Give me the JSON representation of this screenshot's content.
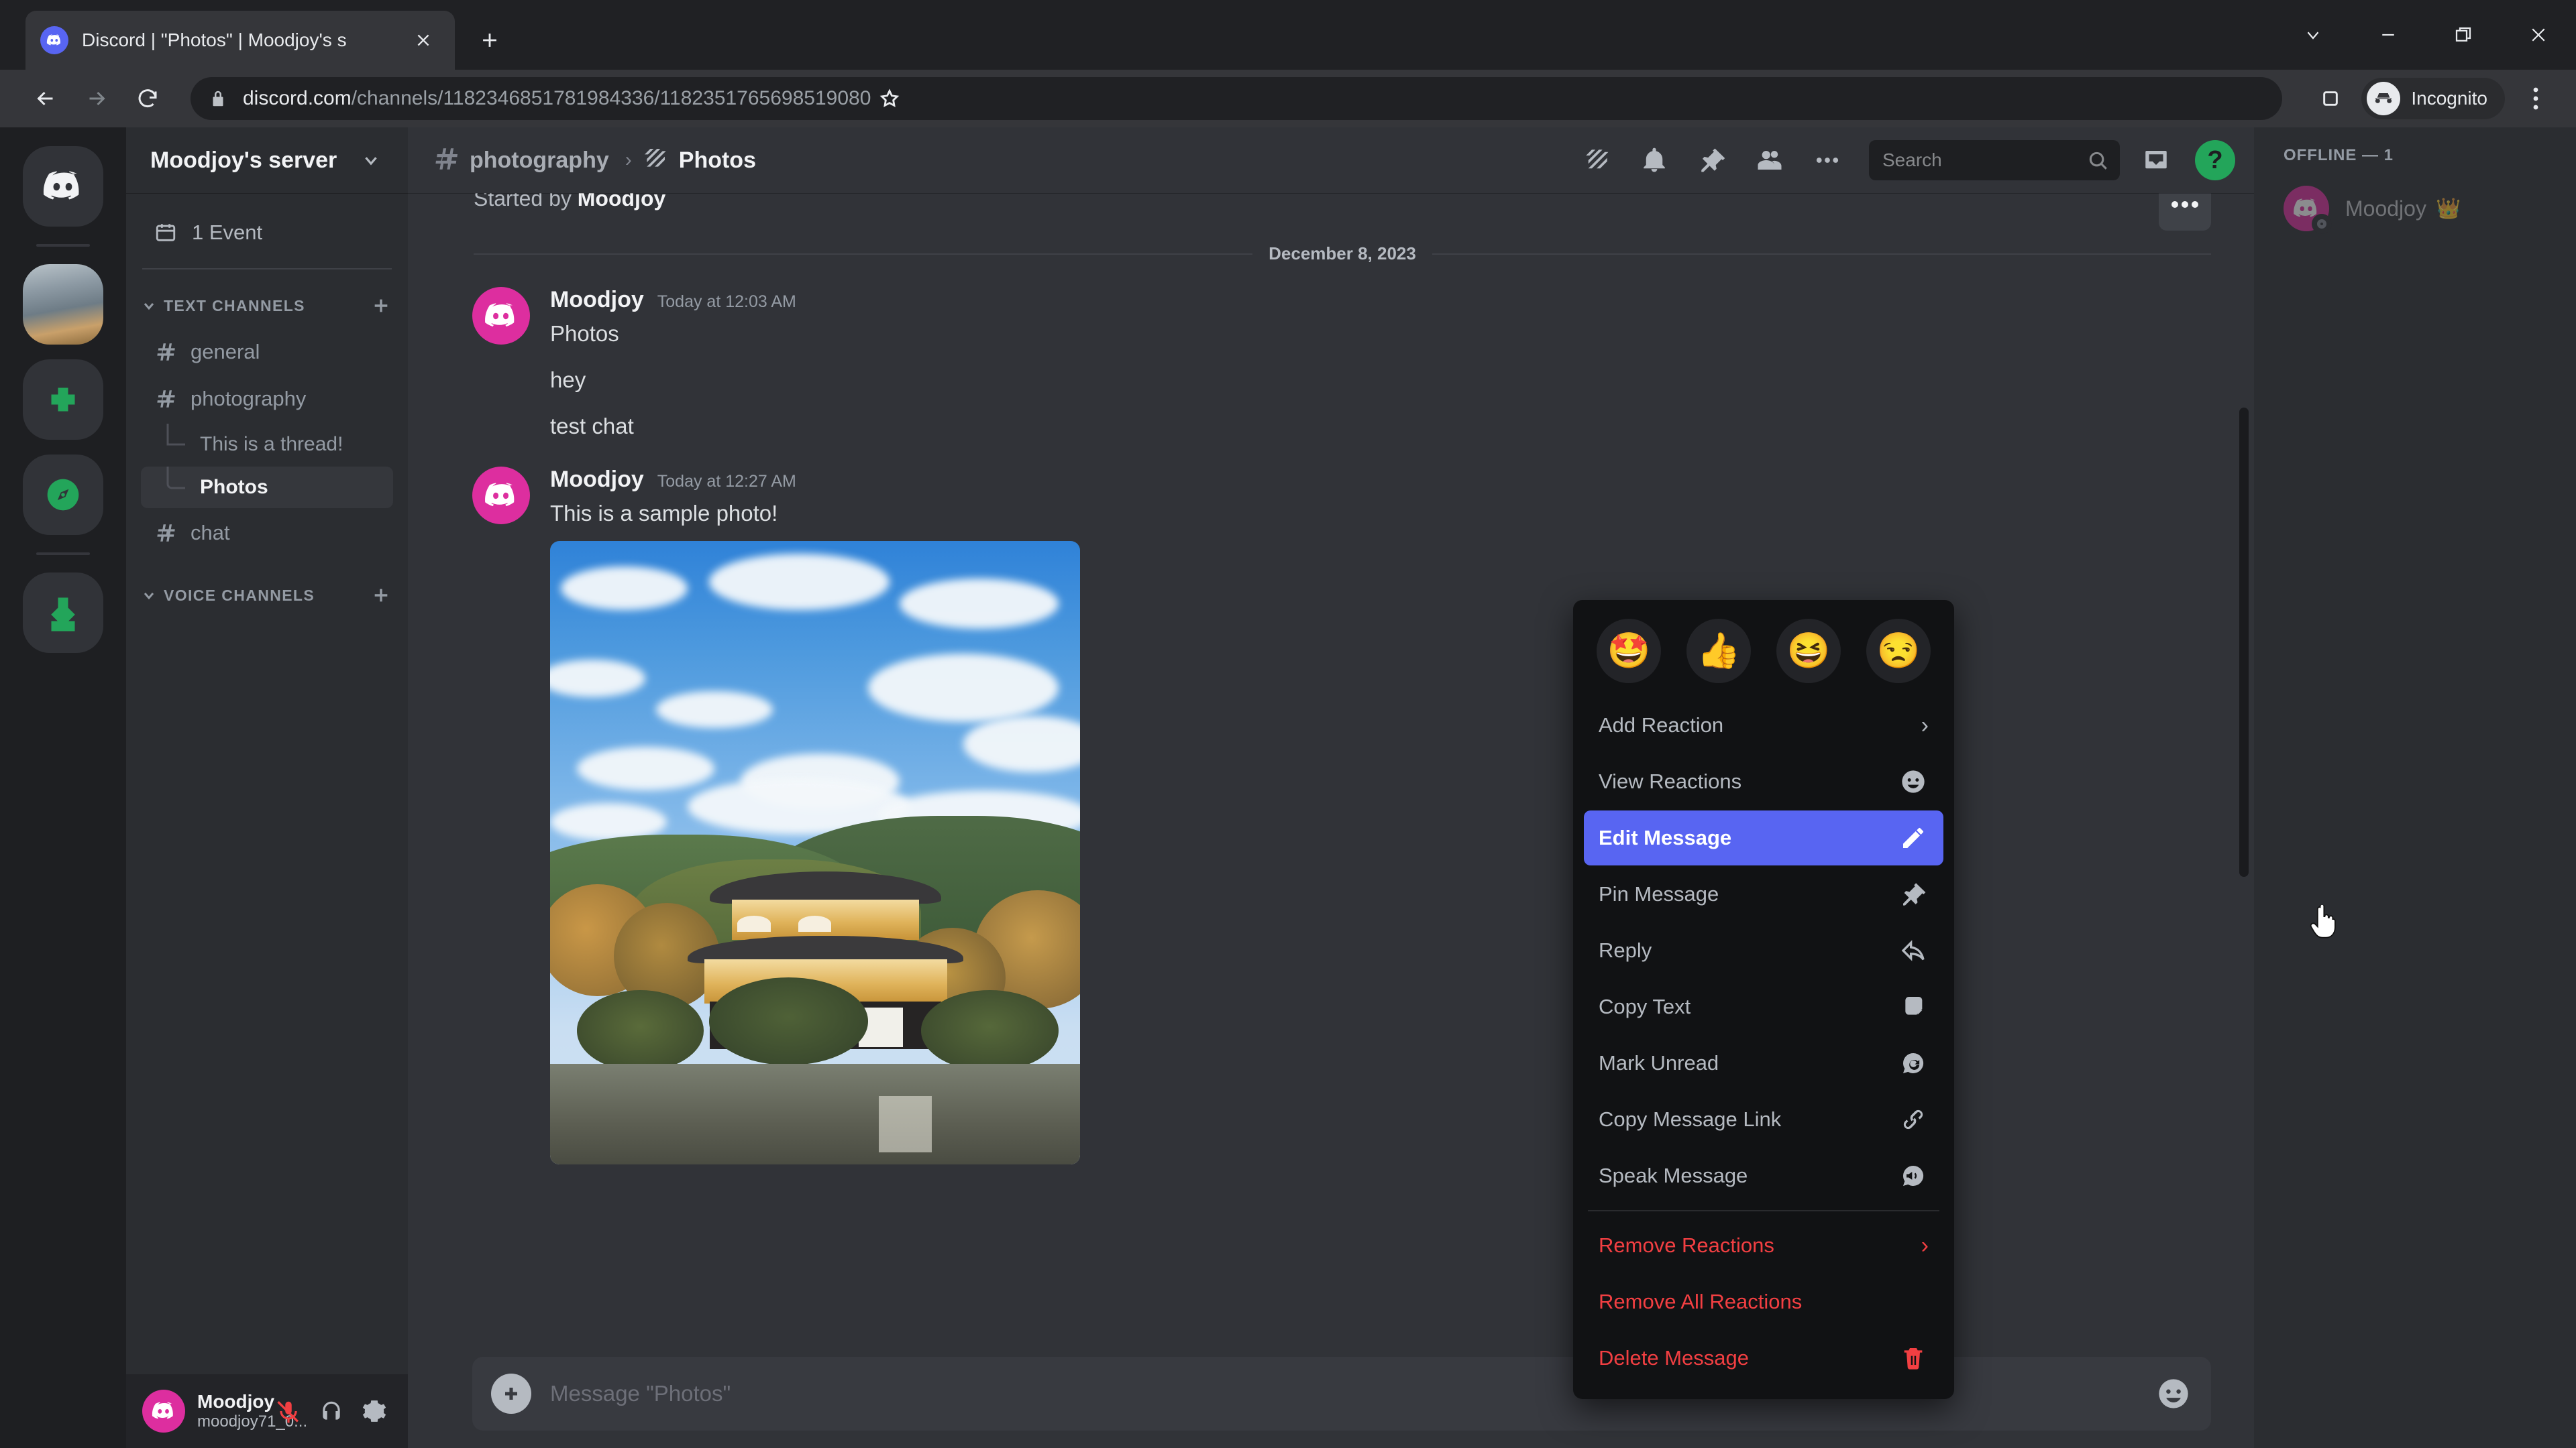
{
  "browser": {
    "tab": {
      "title": "Discord | \"Photos\" | Moodjoy's s",
      "favicon_icon": "discord-icon",
      "close_icon": "close-icon"
    },
    "new_tab_icon": "plus-icon",
    "window_controls": [
      {
        "name": "tab-search",
        "icon": "chevron-down-icon"
      },
      {
        "name": "minimize",
        "icon": "minimize-icon"
      },
      {
        "name": "maximize",
        "icon": "restore-icon"
      },
      {
        "name": "close",
        "icon": "close-icon"
      }
    ],
    "nav": {
      "back_icon": "arrow-left-icon",
      "forward_icon": "arrow-right-icon",
      "reload_icon": "reload-icon"
    },
    "omnibox": {
      "lock_icon": "lock-icon",
      "url_domain": "discord.com",
      "url_path": "/channels/1182346851781984336/1182351765698519080",
      "bookmark_icon": "star-icon"
    },
    "side_panel_icon": "side-panel-icon",
    "profile": {
      "label": "Incognito",
      "icon": "incognito-icon"
    },
    "menu_icon": "kebab-menu-icon"
  },
  "rail": {
    "home_icon": "discord-home-icon",
    "items": [
      {
        "name": "server-moodjoy",
        "type": "server-avatar",
        "active": true
      },
      {
        "name": "add-server",
        "icon": "plus-icon"
      },
      {
        "name": "explore-servers",
        "icon": "compass-icon"
      },
      {
        "name": "download-apps",
        "icon": "download-icon"
      }
    ]
  },
  "sidebar": {
    "server_name": "Moodjoy's server",
    "server_chevron_icon": "chevron-down-icon",
    "event": {
      "label": "1 Event",
      "icon": "calendar-icon"
    },
    "categories": [
      {
        "label": "TEXT CHANNELS",
        "add_icon": "plus-icon",
        "chevron_icon": "chevron-down-icon",
        "channels": [
          {
            "name": "general",
            "icon": "hash-icon",
            "active": false,
            "threads": []
          },
          {
            "name": "photography",
            "icon": "hash-icon",
            "active": false,
            "threads": [
              {
                "name": "This is a thread!",
                "active": false
              },
              {
                "name": "Photos",
                "active": true
              }
            ]
          },
          {
            "name": "chat",
            "icon": "hash-icon",
            "active": false,
            "threads": []
          }
        ]
      },
      {
        "label": "VOICE CHANNELS",
        "add_icon": "plus-icon",
        "chevron_icon": "chevron-down-icon",
        "channels": []
      }
    ],
    "user_panel": {
      "name": "Moodjoy",
      "tag": "moodjoy71_0...",
      "mic_icon": "mic-muted-icon",
      "headset_icon": "headset-icon",
      "settings_icon": "gear-icon"
    }
  },
  "chat_header": {
    "parent_channel": "photography",
    "parent_icon": "hash-icon",
    "separator": "›",
    "thread_name": "Photos",
    "thread_icon": "threads-icon",
    "icons": [
      {
        "name": "threads-icon"
      },
      {
        "name": "notification-bell-icon"
      },
      {
        "name": "pin-icon"
      },
      {
        "name": "members-icon"
      },
      {
        "name": "more-options-icon"
      }
    ],
    "search": {
      "placeholder": "Search",
      "icon": "search-icon"
    },
    "inbox_icon": "inbox-icon",
    "help": {
      "label": "?",
      "icon": "help-icon",
      "color": "#23a55a"
    }
  },
  "conversation": {
    "started_by_prefix": "Started by ",
    "started_by_user": "Moodjoy",
    "date_divider": "December 8, 2023",
    "messages": [
      {
        "author": "Moodjoy",
        "timestamp": "Today at 12:03 AM",
        "lines": [
          "Photos",
          "hey",
          "test chat"
        ],
        "has_photo": false
      },
      {
        "author": "Moodjoy",
        "timestamp": "Today at 12:27 AM",
        "lines": [
          "This is a sample photo!"
        ],
        "has_photo": true,
        "photo_alt": "Kinkaku-ji Golden Pavilion temple with blue sky and pond"
      }
    ],
    "hover_actions": {
      "more_icon": "more-options-icon"
    }
  },
  "composer": {
    "plus_icon": "plus-circle-icon",
    "placeholder": "Message \"Photos\"",
    "emoji_icon": "emoji-icon"
  },
  "members": {
    "category": "OFFLINE — 1",
    "list": [
      {
        "name": "Moodjoy",
        "badge": "👑",
        "status": "offline"
      }
    ]
  },
  "context_menu": {
    "quick_reactions": [
      "🤩",
      "👍",
      "😆",
      "😒"
    ],
    "items": [
      {
        "label": "Add Reaction",
        "icon": "chevron-right-icon",
        "type": "submenu",
        "active": false
      },
      {
        "label": "View Reactions",
        "icon": "smiley-icon",
        "type": "normal",
        "active": false
      },
      {
        "label": "Edit Message",
        "icon": "pencil-icon",
        "type": "normal",
        "active": true
      },
      {
        "label": "Pin Message",
        "icon": "pin-icon",
        "type": "normal",
        "active": false
      },
      {
        "label": "Reply",
        "icon": "reply-arrow-icon",
        "type": "normal",
        "active": false
      },
      {
        "label": "Copy Text",
        "icon": "copy-icon",
        "type": "normal",
        "active": false
      },
      {
        "label": "Mark Unread",
        "icon": "mark-unread-icon",
        "type": "normal",
        "active": false
      },
      {
        "label": "Copy Message Link",
        "icon": "link-icon",
        "type": "normal",
        "active": false
      },
      {
        "label": "Speak Message",
        "icon": "speaker-icon",
        "type": "normal",
        "active": false
      },
      {
        "label": "Remove Reactions",
        "icon": "chevron-right-icon",
        "type": "submenu",
        "danger": true,
        "active": false
      },
      {
        "label": "Remove All Reactions",
        "icon": "",
        "type": "normal",
        "danger": true,
        "active": false
      },
      {
        "label": "Delete Message",
        "icon": "trash-icon",
        "type": "normal",
        "danger": true,
        "active": false
      }
    ],
    "highlight_color": "#5865f2",
    "danger_color": "#f23f42"
  },
  "colors": {
    "discord_blurple": "#5865f2",
    "avatar_pink": "#dd2e9f",
    "green_accent": "#23a55a",
    "chat_bg": "#313338",
    "sidebar_bg": "#2b2d31",
    "rail_bg": "#1e1f22",
    "menu_bg": "#111214"
  }
}
